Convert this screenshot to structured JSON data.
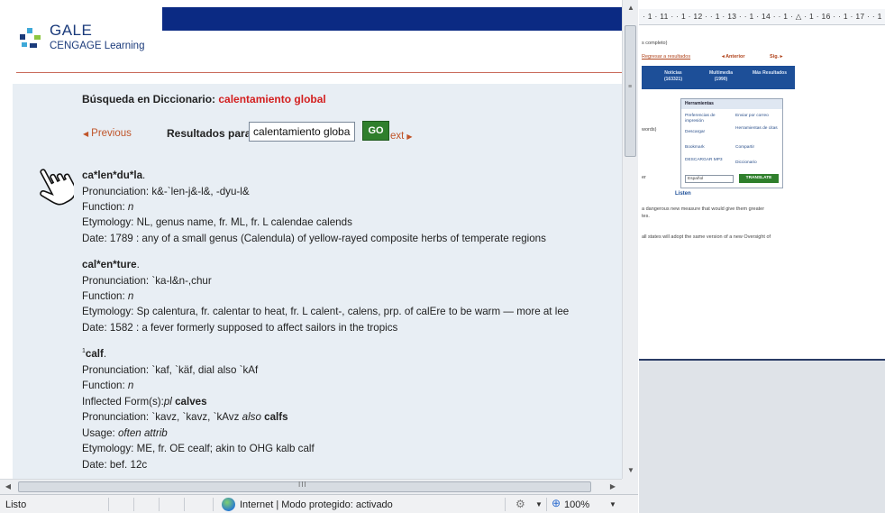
{
  "browser": {
    "logo": {
      "line1": "GALE",
      "line2": "CENGAGE Learning"
    },
    "search": {
      "heading_label": "Búsqueda en Diccionario:",
      "heading_term": "calentamiento global",
      "previous_label": "Previous",
      "results_label": "Resultados para",
      "input_value": "calentamiento global",
      "go_label": "GO",
      "next_label": "ext"
    },
    "entries": [
      {
        "headword": "ca*len*du*la",
        "punct": ".",
        "lines": [
          "Pronunciation: k&-`len-j&-l&, -dyu-l&",
          "Function: ",
          "Etymology: NL, genus name, fr. ML, fr. L calendae calends",
          "Date: 1789 : any of a small genus (Calendula) of yellow-rayed composite herbs of temperate regions"
        ],
        "function_value": "n"
      },
      {
        "headword": "cal*en*ture",
        "punct": ".",
        "lines": [
          "Pronunciation: `ka-l&n-,chur",
          "Function: ",
          "Etymology: Sp calentura, fr. calentar to heat, fr. L calent-, calens, prp. of calEre to be warm — more at lee",
          "Date: 1582 : a fever formerly supposed to affect sailors in the tropics"
        ],
        "function_value": "n"
      },
      {
        "headword": "calf",
        "sup": "1",
        "punct": ".",
        "lines": [
          "Pronunciation: `kaf, `käf, dial also `kAf",
          "Function: "
        ],
        "function_value": "n",
        "inflected_prefix": "Inflected Form(s):",
        "inflected_italic": "pl",
        "inflected_bold": "calves",
        "pron2_prefix": "Pronunciation: `kavz, `kavz, `kAvz ",
        "pron2_italic": "also",
        "pron2_bold": "calfs",
        "usage_prefix": "Usage: ",
        "usage_italic": "often attrib",
        "etymology": "Etymology: ME, fr. OE cealf; akin to OHG kalb calf",
        "date": "Date: bef. 12c"
      }
    ],
    "scrollbar": {
      "h_grip": "III"
    },
    "status": {
      "text": "Listo",
      "zone": "Internet | Modo protegido: activado",
      "zoom": "100%"
    }
  },
  "word_window": {
    "ruler": "· 1 · 11 · · 1 · 12 · · 1 · 13 · · 1 · 14 · · 1 · △ · 1 · 16 · · 1 · 17 · · 1",
    "page": {
      "line1": "s completo)",
      "back_link": "Regresar a resultados",
      "prev": "◂ Anterior",
      "next": "Sig. ▸",
      "tabs": [
        {
          "label": "Noticias",
          "count": "(163321)"
        },
        {
          "label": "Multimedia",
          "count": "(1990)"
        },
        {
          "label": "Más Resultados",
          "count": ""
        }
      ],
      "tools_title": "Herramientas",
      "tools": [
        "Preferencias de impresión",
        "Enviar por correo",
        "Descargar",
        "Herramientas de citas",
        "Bookmark",
        "Compartir",
        "DESCARGAR MP3",
        "Diccionario"
      ],
      "lang": "Español",
      "translate": "TRANSLATE",
      "listen": "Listen",
      "words": "words)",
      "er": "er",
      "para1": "a dangerous new measure that would give them greater",
      "para1b": "tes.",
      "para2": "all states will adopt the same version of a new Oversight of"
    }
  }
}
